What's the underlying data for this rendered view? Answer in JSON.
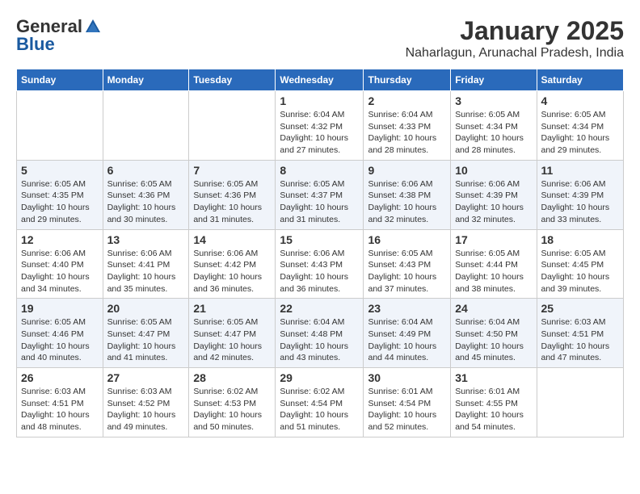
{
  "header": {
    "logo_general": "General",
    "logo_blue": "Blue",
    "title": "January 2025",
    "subtitle": "Naharlagun, Arunachal Pradesh, India"
  },
  "days_of_week": [
    "Sunday",
    "Monday",
    "Tuesday",
    "Wednesday",
    "Thursday",
    "Friday",
    "Saturday"
  ],
  "weeks": [
    [
      {
        "day": "",
        "info": ""
      },
      {
        "day": "",
        "info": ""
      },
      {
        "day": "",
        "info": ""
      },
      {
        "day": "1",
        "info": "Sunrise: 6:04 AM\nSunset: 4:32 PM\nDaylight: 10 hours\nand 27 minutes."
      },
      {
        "day": "2",
        "info": "Sunrise: 6:04 AM\nSunset: 4:33 PM\nDaylight: 10 hours\nand 28 minutes."
      },
      {
        "day": "3",
        "info": "Sunrise: 6:05 AM\nSunset: 4:34 PM\nDaylight: 10 hours\nand 28 minutes."
      },
      {
        "day": "4",
        "info": "Sunrise: 6:05 AM\nSunset: 4:34 PM\nDaylight: 10 hours\nand 29 minutes."
      }
    ],
    [
      {
        "day": "5",
        "info": "Sunrise: 6:05 AM\nSunset: 4:35 PM\nDaylight: 10 hours\nand 29 minutes."
      },
      {
        "day": "6",
        "info": "Sunrise: 6:05 AM\nSunset: 4:36 PM\nDaylight: 10 hours\nand 30 minutes."
      },
      {
        "day": "7",
        "info": "Sunrise: 6:05 AM\nSunset: 4:36 PM\nDaylight: 10 hours\nand 31 minutes."
      },
      {
        "day": "8",
        "info": "Sunrise: 6:05 AM\nSunset: 4:37 PM\nDaylight: 10 hours\nand 31 minutes."
      },
      {
        "day": "9",
        "info": "Sunrise: 6:06 AM\nSunset: 4:38 PM\nDaylight: 10 hours\nand 32 minutes."
      },
      {
        "day": "10",
        "info": "Sunrise: 6:06 AM\nSunset: 4:39 PM\nDaylight: 10 hours\nand 32 minutes."
      },
      {
        "day": "11",
        "info": "Sunrise: 6:06 AM\nSunset: 4:39 PM\nDaylight: 10 hours\nand 33 minutes."
      }
    ],
    [
      {
        "day": "12",
        "info": "Sunrise: 6:06 AM\nSunset: 4:40 PM\nDaylight: 10 hours\nand 34 minutes."
      },
      {
        "day": "13",
        "info": "Sunrise: 6:06 AM\nSunset: 4:41 PM\nDaylight: 10 hours\nand 35 minutes."
      },
      {
        "day": "14",
        "info": "Sunrise: 6:06 AM\nSunset: 4:42 PM\nDaylight: 10 hours\nand 36 minutes."
      },
      {
        "day": "15",
        "info": "Sunrise: 6:06 AM\nSunset: 4:43 PM\nDaylight: 10 hours\nand 36 minutes."
      },
      {
        "day": "16",
        "info": "Sunrise: 6:05 AM\nSunset: 4:43 PM\nDaylight: 10 hours\nand 37 minutes."
      },
      {
        "day": "17",
        "info": "Sunrise: 6:05 AM\nSunset: 4:44 PM\nDaylight: 10 hours\nand 38 minutes."
      },
      {
        "day": "18",
        "info": "Sunrise: 6:05 AM\nSunset: 4:45 PM\nDaylight: 10 hours\nand 39 minutes."
      }
    ],
    [
      {
        "day": "19",
        "info": "Sunrise: 6:05 AM\nSunset: 4:46 PM\nDaylight: 10 hours\nand 40 minutes."
      },
      {
        "day": "20",
        "info": "Sunrise: 6:05 AM\nSunset: 4:47 PM\nDaylight: 10 hours\nand 41 minutes."
      },
      {
        "day": "21",
        "info": "Sunrise: 6:05 AM\nSunset: 4:47 PM\nDaylight: 10 hours\nand 42 minutes."
      },
      {
        "day": "22",
        "info": "Sunrise: 6:04 AM\nSunset: 4:48 PM\nDaylight: 10 hours\nand 43 minutes."
      },
      {
        "day": "23",
        "info": "Sunrise: 6:04 AM\nSunset: 4:49 PM\nDaylight: 10 hours\nand 44 minutes."
      },
      {
        "day": "24",
        "info": "Sunrise: 6:04 AM\nSunset: 4:50 PM\nDaylight: 10 hours\nand 45 minutes."
      },
      {
        "day": "25",
        "info": "Sunrise: 6:03 AM\nSunset: 4:51 PM\nDaylight: 10 hours\nand 47 minutes."
      }
    ],
    [
      {
        "day": "26",
        "info": "Sunrise: 6:03 AM\nSunset: 4:51 PM\nDaylight: 10 hours\nand 48 minutes."
      },
      {
        "day": "27",
        "info": "Sunrise: 6:03 AM\nSunset: 4:52 PM\nDaylight: 10 hours\nand 49 minutes."
      },
      {
        "day": "28",
        "info": "Sunrise: 6:02 AM\nSunset: 4:53 PM\nDaylight: 10 hours\nand 50 minutes."
      },
      {
        "day": "29",
        "info": "Sunrise: 6:02 AM\nSunset: 4:54 PM\nDaylight: 10 hours\nand 51 minutes."
      },
      {
        "day": "30",
        "info": "Sunrise: 6:01 AM\nSunset: 4:54 PM\nDaylight: 10 hours\nand 52 minutes."
      },
      {
        "day": "31",
        "info": "Sunrise: 6:01 AM\nSunset: 4:55 PM\nDaylight: 10 hours\nand 54 minutes."
      },
      {
        "day": "",
        "info": ""
      }
    ]
  ]
}
